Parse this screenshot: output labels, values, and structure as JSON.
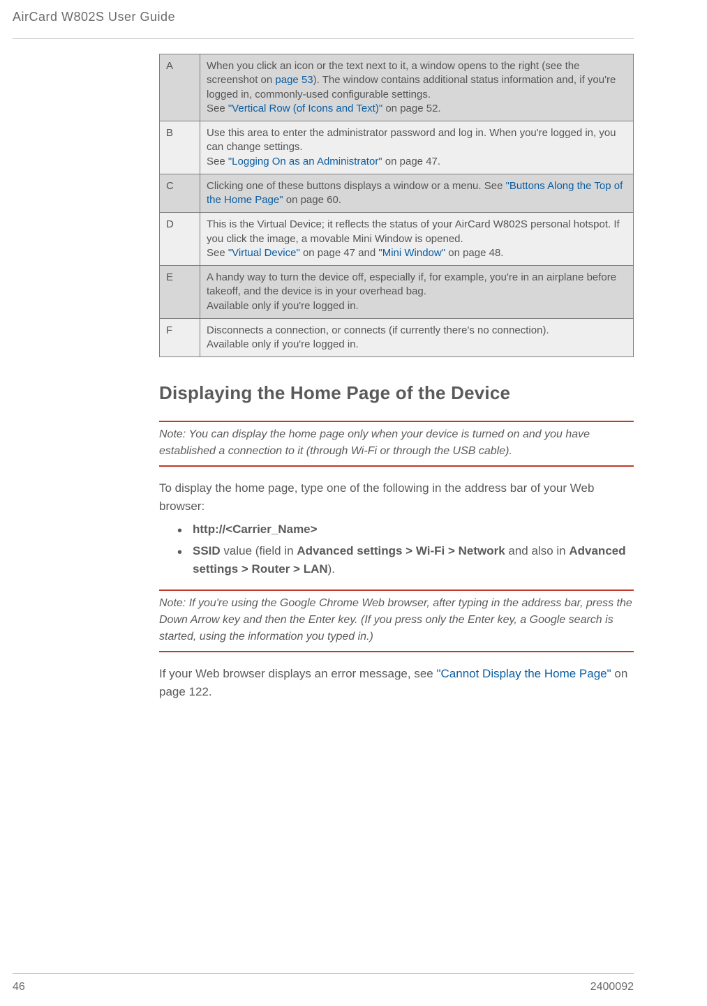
{
  "header": {
    "title": "AirCard W802S User Guide"
  },
  "table": {
    "rows": [
      {
        "letter": "A",
        "parts": [
          {
            "t": "When you click an icon or the text next to it, a window opens to the right (see the screenshot on "
          },
          {
            "t": "page 53",
            "link": true
          },
          {
            "t": "). The window contains additional status information and, if you're logged in, commonly-used configurable settings."
          },
          {
            "br": true
          },
          {
            "t": "See "
          },
          {
            "t": "\"Vertical Row (of Icons and Text)\"",
            "link": true
          },
          {
            "t": " on page 52."
          }
        ]
      },
      {
        "letter": "B",
        "parts": [
          {
            "t": "Use this area to enter the administrator password and log in. When you're logged in, you can change settings."
          },
          {
            "br": true
          },
          {
            "t": "See "
          },
          {
            "t": "\"Logging On as an Administrator\"",
            "link": true
          },
          {
            "t": " on page 47."
          }
        ]
      },
      {
        "letter": "C",
        "parts": [
          {
            "t": "Clicking one of these buttons displays a window or a menu. See "
          },
          {
            "t": "\"Buttons Along the Top of the Home Page\"",
            "link": true
          },
          {
            "t": " on page 60."
          }
        ]
      },
      {
        "letter": "D",
        "parts": [
          {
            "t": "This is the Virtual Device; it reflects the status of your AirCard W802S personal hotspot. If you click the image, a movable Mini Window is opened."
          },
          {
            "br": true
          },
          {
            "t": "See "
          },
          {
            "t": "\"Virtual Device\"",
            "link": true
          },
          {
            "t": " on page 47 and "
          },
          {
            "t": "\"Mini Window\"",
            "link": true
          },
          {
            "t": " on page 48."
          }
        ]
      },
      {
        "letter": "E",
        "parts": [
          {
            "t": "A handy way to turn the device off, especially if, for example, you're in an airplane before takeoff, and the device is in your overhead bag."
          },
          {
            "br": true
          },
          {
            "t": "Available only if you're logged in."
          }
        ]
      },
      {
        "letter": "F",
        "parts": [
          {
            "t": "Disconnects a connection, or connects (if currently there's no connection)."
          },
          {
            "br": true
          },
          {
            "t": "Available only if you're logged in."
          }
        ]
      }
    ]
  },
  "heading": "Displaying the Home Page of the Device",
  "note1": {
    "label": "Note: ",
    "text": "You can display the home page only when your device is turned on and you have established a connection to it (through Wi-Fi or through the USB cable)."
  },
  "body1": "To display the home page, type one of the following in the address bar of your Web browser:",
  "bullets": [
    {
      "parts": [
        {
          "t": "http://<Carrier_Name>",
          "bold": true
        }
      ]
    },
    {
      "parts": [
        {
          "t": "SSID",
          "bold": true
        },
        {
          "t": " value (field in "
        },
        {
          "t": "Advanced settings > Wi-Fi > Network",
          "bold": true
        },
        {
          "t": " and also in "
        },
        {
          "t": "Advanced settings > Router > LAN",
          "bold": true
        },
        {
          "t": ")."
        }
      ]
    }
  ],
  "note2": {
    "label": "Note: ",
    "text": "If you're using the Google Chrome Web browser, after typing in the address bar, press the Down Arrow key and then the Enter key. (If you press only the Enter key, a Google search is started, using the information you typed in.)"
  },
  "body2": {
    "parts": [
      {
        "t": "If your Web browser displays an error message, see "
      },
      {
        "t": "\"Cannot Display the Home Page\"",
        "link": true
      },
      {
        "t": " on page 122."
      }
    ]
  },
  "footer": {
    "page": "46",
    "docnum": "2400092"
  }
}
